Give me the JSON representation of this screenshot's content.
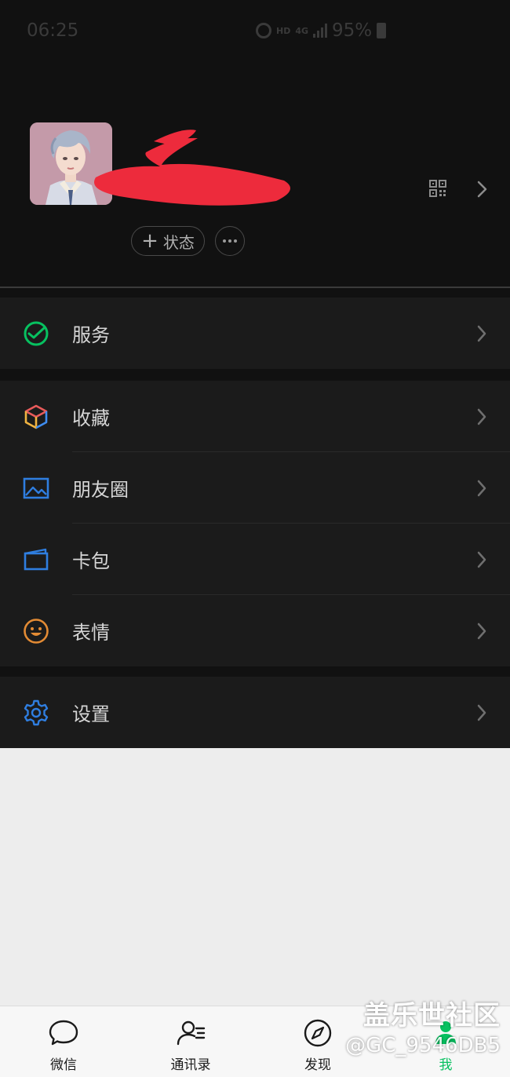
{
  "status_bar": {
    "time": "06:25",
    "network_hd": "HD",
    "network_gen": "4G",
    "battery": "95%"
  },
  "profile": {
    "status_button_plus": "+",
    "status_button_label": "状态",
    "more_button_icon": "ellipsis-icon"
  },
  "menu": {
    "services": {
      "label": "服务",
      "icon": "wechat-pay-icon",
      "color": "#07c160"
    },
    "favorites": {
      "label": "收藏",
      "icon": "cube-icon"
    },
    "moments": {
      "label": "朋友圈",
      "icon": "picture-icon",
      "color": "#2f7ee0"
    },
    "cards": {
      "label": "卡包",
      "icon": "card-icon",
      "color": "#2f7ee0"
    },
    "stickers": {
      "label": "表情",
      "icon": "smiley-icon",
      "color": "#e38b34"
    },
    "settings": {
      "label": "设置",
      "icon": "gear-icon",
      "color": "#2f7ee0"
    }
  },
  "tabbar": {
    "chats": "微信",
    "contacts": "通讯录",
    "discover": "发现",
    "me": "我",
    "active_color": "#07c160"
  },
  "watermark": {
    "line1": "盖乐世社区",
    "line2": "@GC_9546DB5"
  }
}
